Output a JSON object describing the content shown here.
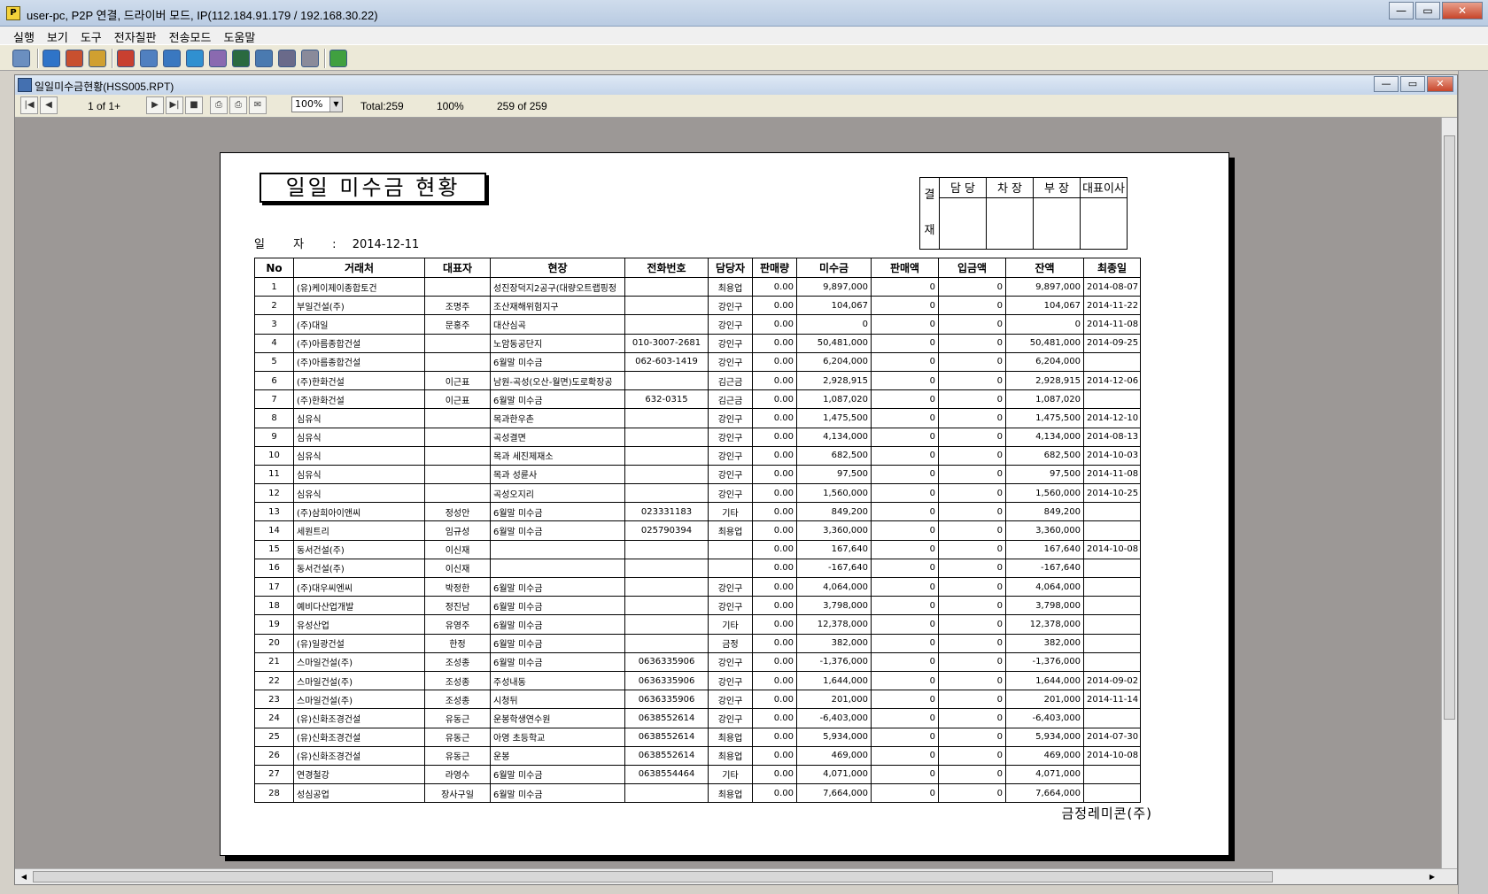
{
  "window": {
    "title": "user-pc, P2P 연결, 드라이버 모드, IP(112.184.91.179 / 192.168.30.22)",
    "app_icon": "P"
  },
  "menu": [
    "실행",
    "보기",
    "도구",
    "전자칠판",
    "전송모드",
    "도움말"
  ],
  "child": {
    "title": "일일미수금현황(HSS005.RPT)"
  },
  "report_toolbar": {
    "page": "1 of 1+",
    "zoom": "100%",
    "total": "Total:259",
    "percent": "100%",
    "records": "259 of 259"
  },
  "report": {
    "title": "일일 미수금 현황",
    "date_label": "일 자 :",
    "date_value": "2014-12-11",
    "approval": {
      "side_top": "결",
      "side_bottom": "재",
      "roles": [
        "담 당",
        "차 장",
        "부 장",
        "대표이사"
      ]
    },
    "columns": [
      "No",
      "거래처",
      "대표자",
      "현장",
      "전화번호",
      "담당자",
      "판매량",
      "미수금",
      "판매액",
      "입금액",
      "잔액",
      "최종일"
    ],
    "rows": [
      [
        "1",
        "(유)케이제이종합토건",
        "",
        "성진장덕지2공구(대량오트랩핑정",
        "",
        "최용업",
        "0.00",
        "9,897,000",
        "0",
        "0",
        "9,897,000",
        "2014-08-07"
      ],
      [
        "2",
        "부일건설(주)",
        "조명주",
        "조산재해위험지구",
        "",
        "강인구",
        "0.00",
        "104,067",
        "0",
        "0",
        "104,067",
        "2014-11-22"
      ],
      [
        "3",
        "(주)대일",
        "문홍주",
        "대산심곡",
        "",
        "강인구",
        "0.00",
        "0",
        "0",
        "0",
        "0",
        "2014-11-08"
      ],
      [
        "4",
        "(주)아름종합건설",
        "",
        "노암동공단지",
        "010-3007-2681",
        "강인구",
        "0.00",
        "50,481,000",
        "0",
        "0",
        "50,481,000",
        "2014-09-25"
      ],
      [
        "5",
        "(주)아름종합건설",
        "",
        "6월말 미수금",
        "062-603-1419",
        "강인구",
        "0.00",
        "6,204,000",
        "0",
        "0",
        "6,204,000",
        ""
      ],
      [
        "6",
        "(주)한화건설",
        "이근표",
        "남원-곡성(오산-월면)도로확장공",
        "",
        "김근금",
        "0.00",
        "2,928,915",
        "0",
        "0",
        "2,928,915",
        "2014-12-06"
      ],
      [
        "7",
        "(주)한화건설",
        "이근표",
        "6월말 미수금",
        "632-0315",
        "김근금",
        "0.00",
        "1,087,020",
        "0",
        "0",
        "1,087,020",
        ""
      ],
      [
        "8",
        "심유식",
        "",
        "목과한우촌",
        "",
        "강인구",
        "0.00",
        "1,475,500",
        "0",
        "0",
        "1,475,500",
        "2014-12-10"
      ],
      [
        "9",
        "심유식",
        "",
        "곡성결면",
        "",
        "강인구",
        "0.00",
        "4,134,000",
        "0",
        "0",
        "4,134,000",
        "2014-08-13"
      ],
      [
        "10",
        "심유식",
        "",
        "목과 세진제재소",
        "",
        "강인구",
        "0.00",
        "682,500",
        "0",
        "0",
        "682,500",
        "2014-10-03"
      ],
      [
        "11",
        "심유식",
        "",
        "목과 성륜사",
        "",
        "강인구",
        "0.00",
        "97,500",
        "0",
        "0",
        "97,500",
        "2014-11-08"
      ],
      [
        "12",
        "심유식",
        "",
        "곡성오지리",
        "",
        "강인구",
        "0.00",
        "1,560,000",
        "0",
        "0",
        "1,560,000",
        "2014-10-25"
      ],
      [
        "13",
        "(주)삼희아이앤씨",
        "정성안",
        "6월말 미수금",
        "023331183",
        "기타",
        "0.00",
        "849,200",
        "0",
        "0",
        "849,200",
        ""
      ],
      [
        "14",
        "세원트리",
        "임규성",
        "6월말 미수금",
        "025790394",
        "최용업",
        "0.00",
        "3,360,000",
        "0",
        "0",
        "3,360,000",
        ""
      ],
      [
        "15",
        "동서건설(주)",
        "이신재",
        "",
        "",
        "",
        "0.00",
        "167,640",
        "0",
        "0",
        "167,640",
        "2014-10-08"
      ],
      [
        "16",
        "동서건설(주)",
        "이신재",
        "",
        "",
        "",
        "0.00",
        "-167,640",
        "0",
        "0",
        "-167,640",
        ""
      ],
      [
        "17",
        "(주)대우씨엔씨",
        "박정한",
        "6월말 미수금",
        "",
        "강인구",
        "0.00",
        "4,064,000",
        "0",
        "0",
        "4,064,000",
        ""
      ],
      [
        "18",
        "예비다산업개발",
        "정진남",
        "6월말 미수금",
        "",
        "강인구",
        "0.00",
        "3,798,000",
        "0",
        "0",
        "3,798,000",
        ""
      ],
      [
        "19",
        "유성산업",
        "유영주",
        "6월말 미수금",
        "",
        "기타",
        "0.00",
        "12,378,000",
        "0",
        "0",
        "12,378,000",
        ""
      ],
      [
        "20",
        "(유)일광건설",
        "한정",
        "6월말 미수금",
        "",
        "금정",
        "0.00",
        "382,000",
        "0",
        "0",
        "382,000",
        ""
      ],
      [
        "21",
        "스마일건설(주)",
        "조성종",
        "6월말 미수금",
        "0636335906",
        "강인구",
        "0.00",
        "-1,376,000",
        "0",
        "0",
        "-1,376,000",
        ""
      ],
      [
        "22",
        "스마일건설(주)",
        "조성종",
        "주성내동",
        "0636335906",
        "강인구",
        "0.00",
        "1,644,000",
        "0",
        "0",
        "1,644,000",
        "2014-09-02"
      ],
      [
        "23",
        "스마일건설(주)",
        "조성종",
        "시청뒤",
        "0636335906",
        "강인구",
        "0.00",
        "201,000",
        "0",
        "0",
        "201,000",
        "2014-11-14"
      ],
      [
        "24",
        "(유)신화조경건설",
        "유동근",
        "운봉학생연수원",
        "0638552614",
        "강인구",
        "0.00",
        "-6,403,000",
        "0",
        "0",
        "-6,403,000",
        ""
      ],
      [
        "25",
        "(유)신화조경건설",
        "유동근",
        "아영 초등학교",
        "0638552614",
        "최용업",
        "0.00",
        "5,934,000",
        "0",
        "0",
        "5,934,000",
        "2014-07-30"
      ],
      [
        "26",
        "(유)신화조경건설",
        "유동근",
        "운봉",
        "0638552614",
        "최용업",
        "0.00",
        "469,000",
        "0",
        "0",
        "469,000",
        "2014-10-08"
      ],
      [
        "27",
        "연경철강",
        "라영수",
        "6월말 미수금",
        "0638554464",
        "기타",
        "0.00",
        "4,071,000",
        "0",
        "0",
        "4,071,000",
        ""
      ],
      [
        "28",
        "성심공업",
        "장사구일",
        "6월말 미수금",
        "",
        "최용업",
        "0.00",
        "7,664,000",
        "0",
        "0",
        "7,664,000",
        ""
      ]
    ],
    "company": "금정레미콘(주)"
  }
}
